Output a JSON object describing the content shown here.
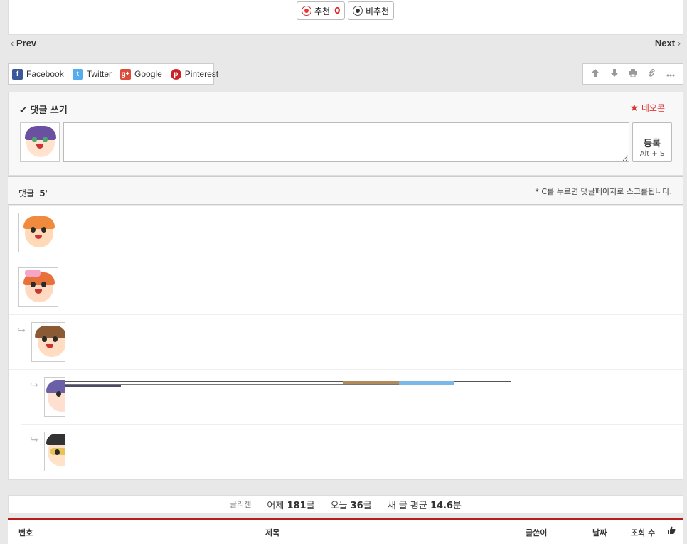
{
  "vote": {
    "recommend_label": "추천",
    "recommend_count": "0",
    "not_recommend_label": "비추천"
  },
  "nav": {
    "prev": "Prev",
    "next": "Next"
  },
  "share": {
    "facebook": "Facebook",
    "twitter": "Twitter",
    "google": "Google",
    "pinterest": "Pinterest"
  },
  "tools": [
    "arrow-up-icon",
    "arrow-down-icon",
    "print-icon",
    "paperclip-icon",
    "more-icon"
  ],
  "write": {
    "title": "댓글 쓰기",
    "neocon": "네오콘",
    "input_value": "",
    "submit_label": "등록",
    "submit_shortcut": "Alt + S"
  },
  "comments": {
    "count_prefix": "댓글 '",
    "count": "5",
    "count_suffix": "'",
    "notice": "* C를 누르면 댓글페이지로 스크롤됩니다."
  },
  "stats": {
    "label": "글리젠",
    "yesterday_label": "어제",
    "yesterday_value": "181",
    "yesterday_unit": "글",
    "today_label": "오늘",
    "today_value": "36",
    "today_unit": "글",
    "avg_label": "새 글 평균",
    "avg_value": "14.6",
    "avg_unit": "분"
  },
  "table": {
    "col_no": "번호",
    "col_title": "제목",
    "col_author": "글쓴이",
    "col_date": "날짜",
    "col_views": "조회 수"
  },
  "colors": {
    "accent_red": "#b71c1c",
    "count_red": "#dd2222"
  }
}
